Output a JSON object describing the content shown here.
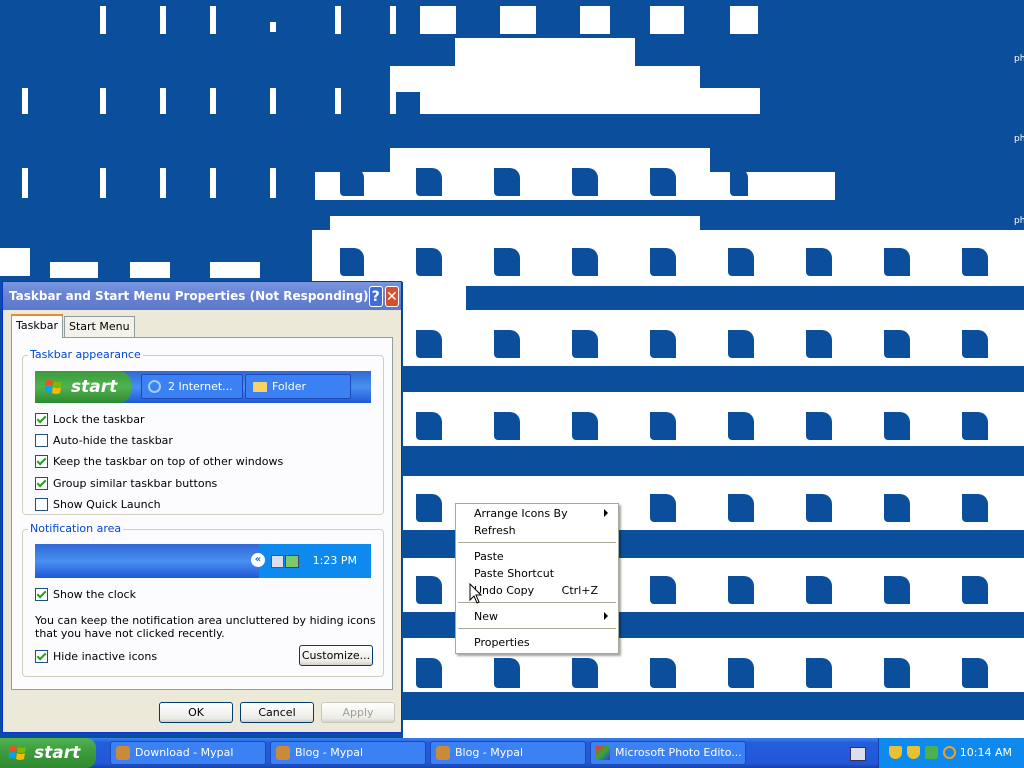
{
  "desktop": {
    "side_labels": [
      "ph",
      "ph",
      "ph"
    ]
  },
  "dialog": {
    "title": "Taskbar and Start Menu Properties (Not Responding)",
    "help_label": "?",
    "close_label": "✕",
    "tabs": [
      "Taskbar",
      "Start Menu"
    ],
    "active_tab": "Taskbar",
    "appearance": {
      "legend": "Taskbar appearance",
      "preview": {
        "start": "start",
        "button1": "2 Internet...",
        "button2": "Folder"
      },
      "options": [
        {
          "label": "Lock the taskbar",
          "checked": true
        },
        {
          "label": "Auto-hide the taskbar",
          "checked": false
        },
        {
          "label": "Keep the taskbar on top of other windows",
          "checked": true
        },
        {
          "label": "Group similar taskbar buttons",
          "checked": true
        },
        {
          "label": "Show Quick Launch",
          "checked": false
        }
      ]
    },
    "notification": {
      "legend": "Notification area",
      "preview_clock": "1:23 PM",
      "show_clock": {
        "label": "Show the clock",
        "checked": true
      },
      "description": "You can keep the notification area uncluttered by hiding icons that you have not clicked recently.",
      "hide_inactive": {
        "label": "Hide inactive icons",
        "checked": true
      },
      "customize_label": "Customize..."
    },
    "buttons": {
      "ok": "OK",
      "cancel": "Cancel",
      "apply": "Apply"
    }
  },
  "context_menu": {
    "items": [
      {
        "label": "Arrange Icons By",
        "submenu": true
      },
      {
        "label": "Refresh"
      },
      {
        "label": "Paste"
      },
      {
        "label": "Paste Shortcut"
      },
      {
        "label": "Undo Copy",
        "shortcut": "Ctrl+Z"
      },
      {
        "label": "New",
        "submenu": true
      },
      {
        "label": "Properties"
      }
    ]
  },
  "taskbar": {
    "start_label": "start",
    "tasks": [
      "Download - Mypal",
      "Blog - Mypal",
      "Blog - Mypal",
      "Microsoft Photo Edito..."
    ],
    "clock": "10:14 AM"
  },
  "colors": {
    "desktop": "#0B4F9C",
    "taskbar": "#245EDB",
    "start": "#3C9A3C",
    "tray": "#0E8AEE"
  }
}
